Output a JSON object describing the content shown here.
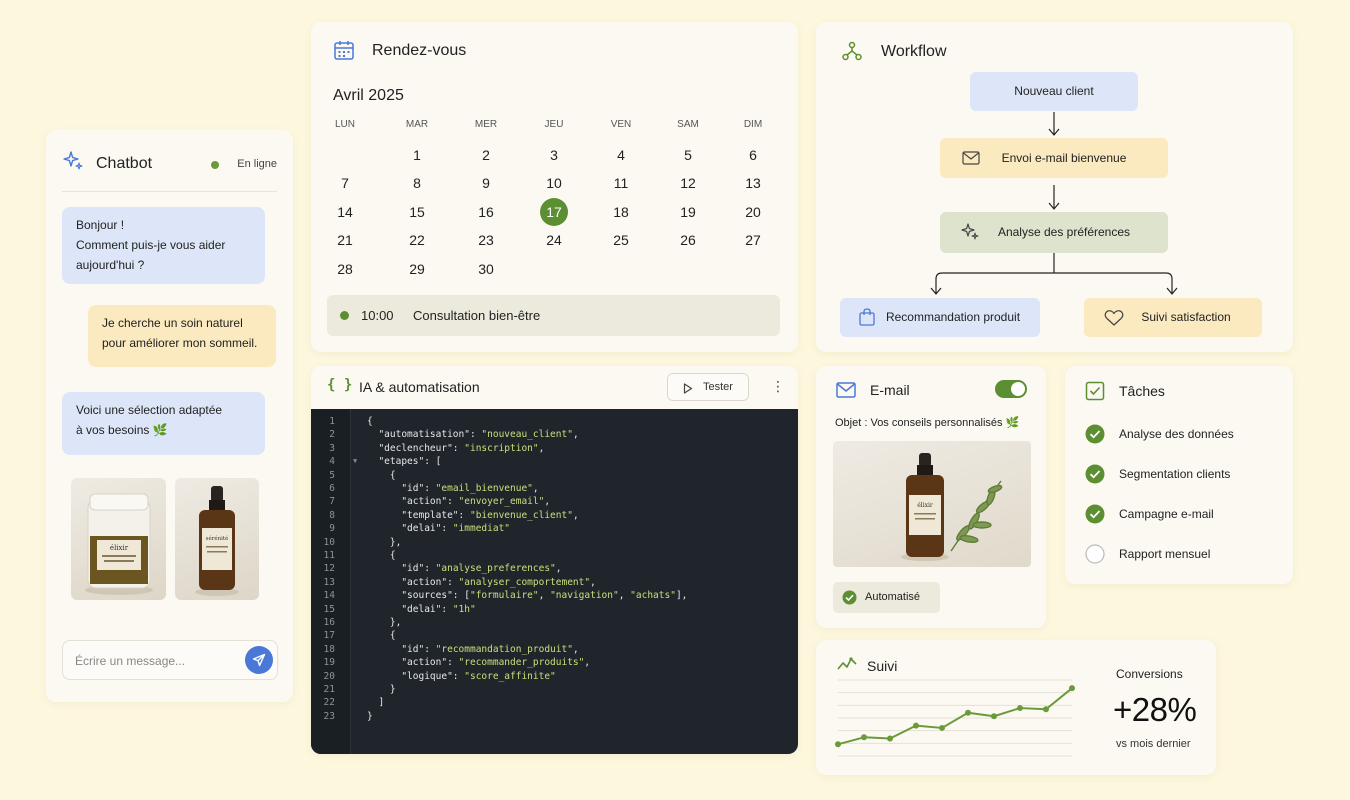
{
  "chatbot": {
    "title": "Chatbot",
    "status": "En ligne",
    "messages": [
      {
        "from": "bot",
        "lines": [
          "Bonjour !",
          "Comment puis-je vous aider",
          "aujourd'hui ?"
        ]
      },
      {
        "from": "user",
        "lines": [
          "Je cherche un soin naturel",
          "pour améliorer mon sommeil."
        ]
      },
      {
        "from": "bot",
        "lines": [
          "Voici une sélection adaptée",
          "à vos besoins 🌿"
        ]
      }
    ],
    "products": [
      {
        "label": "élixir"
      },
      {
        "label": "sérénité"
      }
    ],
    "input_placeholder": "Écrire un message..."
  },
  "calendar": {
    "title": "Rendez-vous",
    "month": "Avril 2025",
    "weekdays": [
      "LUN",
      "MAR",
      "MER",
      "JEU",
      "VEN",
      "SAM",
      "DIM"
    ],
    "weeks": [
      [
        "",
        "1",
        "2",
        "3",
        "4",
        "5",
        "6"
      ],
      [
        "7",
        "8",
        "9",
        "10",
        "11",
        "12",
        "13"
      ],
      [
        "14",
        "15",
        "16",
        "17",
        "18",
        "19",
        "20"
      ],
      [
        "21",
        "22",
        "23",
        "24",
        "25",
        "26",
        "27"
      ],
      [
        "28",
        "29",
        "30",
        "",
        "",
        "",
        ""
      ]
    ],
    "selected_day": "17",
    "appointment": {
      "time": "10:00",
      "label": "Consultation bien-être"
    }
  },
  "workflow": {
    "title": "Workflow",
    "nodes": {
      "start": "Nouveau client",
      "email": "Envoi e-mail bienvenue",
      "analyse": "Analyse des préférences",
      "reco": "Recommandation produit",
      "suivi": "Suivi satisfaction"
    }
  },
  "code": {
    "title": "IA & automatisation",
    "brace_icon": "{ }",
    "test_label": "Tester",
    "lines": [
      "{",
      "  \"automatisation\": \"nouveau_client\",",
      "  \"declencheur\": \"inscription\",",
      "  \"etapes\": [",
      "    {",
      "      \"id\": \"email_bienvenue\",",
      "      \"action\": \"envoyer_email\",",
      "      \"template\": \"bienvenue_client\",",
      "      \"delai\": \"immediat\"",
      "    },",
      "    {",
      "      \"id\": \"analyse_preferences\",",
      "      \"action\": \"analyser_comportement\",",
      "      \"sources\": [\"formulaire\", \"navigation\", \"achats\"],",
      "      \"delai\": \"1h\"",
      "    },",
      "    {",
      "      \"id\": \"recommandation_produit\",",
      "      \"action\": \"recommander_produits\",",
      "      \"logique\": \"score_affinite\"",
      "    }",
      "  ]",
      "}"
    ]
  },
  "email": {
    "title": "E-mail",
    "toggle_on": true,
    "subject": "Objet : Vos conseils personnalisés 🌿",
    "product_label": "élixir",
    "status": "Automatisé"
  },
  "tasks": {
    "title": "Tâches",
    "items": [
      {
        "label": "Analyse des données",
        "done": true
      },
      {
        "label": "Segmentation clients",
        "done": true
      },
      {
        "label": "Campagne e-mail",
        "done": true
      },
      {
        "label": "Rapport mensuel",
        "done": false
      }
    ]
  },
  "suivi": {
    "title": "Suivi",
    "metric_label": "Conversions",
    "metric_value": "+28%",
    "metric_sub": "vs mois dernier",
    "chart_data": {
      "type": "line",
      "x": [
        1,
        2,
        3,
        4,
        5,
        6,
        7,
        8,
        9,
        10
      ],
      "values": [
        10,
        16,
        15,
        26,
        24,
        37,
        34,
        41,
        40,
        58
      ],
      "ylim": [
        0,
        65
      ],
      "grid": true
    }
  },
  "colors": {
    "accent_green": "#5c8f31",
    "blue": "#4a78d8",
    "bubble_blue": "#dde6f8",
    "bubble_yellow": "#fbe9bf",
    "background": "#fdf7de"
  }
}
